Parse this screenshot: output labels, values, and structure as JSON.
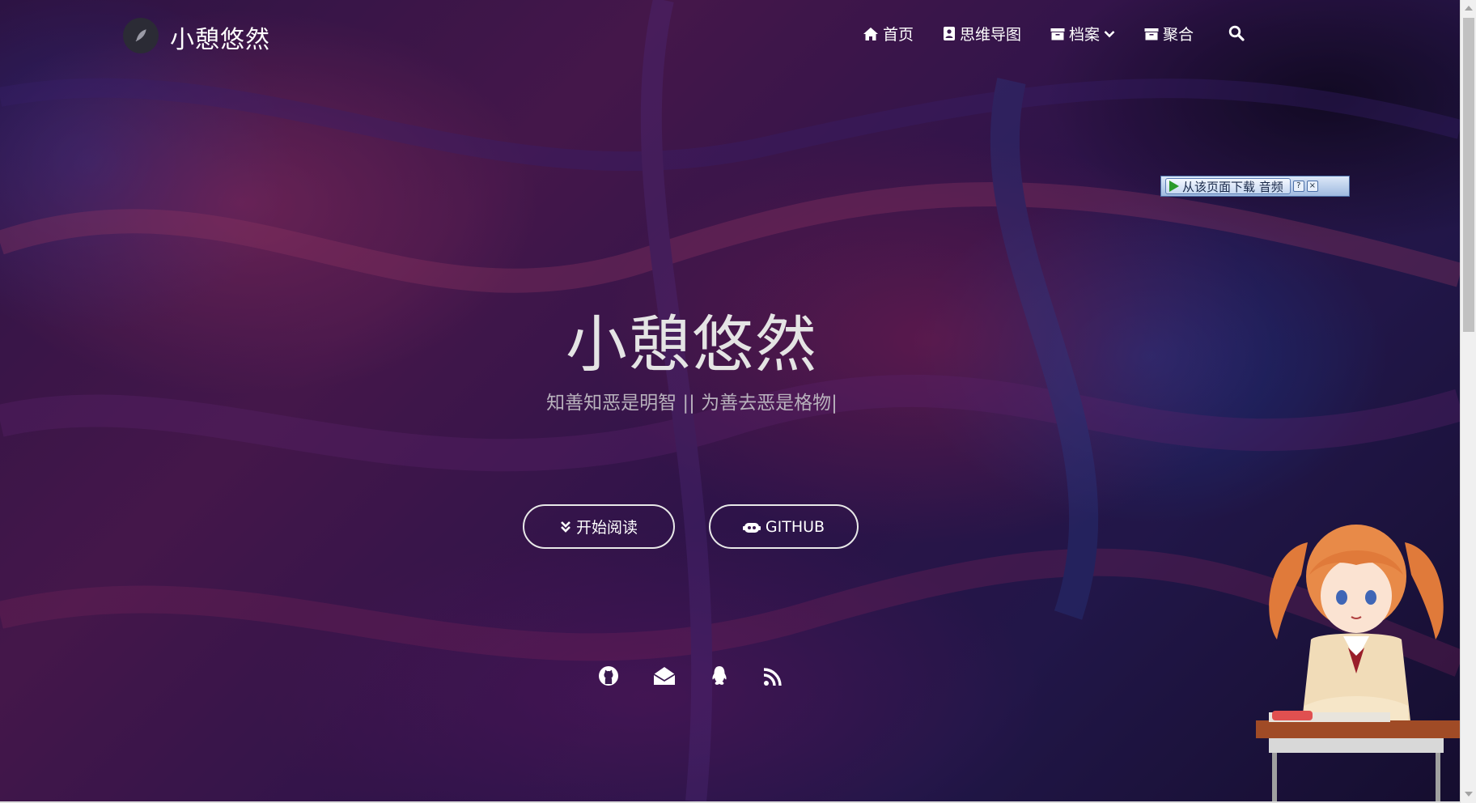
{
  "site": {
    "name": "小憩悠然"
  },
  "nav": {
    "items": [
      {
        "label": "首页",
        "icon": "home-icon"
      },
      {
        "label": "思维导图",
        "icon": "address-card-icon"
      },
      {
        "label": "档案",
        "icon": "archive-icon",
        "has_dropdown": true
      },
      {
        "label": "聚合",
        "icon": "archive-icon"
      }
    ],
    "search_icon": "search-icon"
  },
  "download_bar": {
    "label": "从该页面下载 音频",
    "help": "?",
    "close": "×"
  },
  "hero": {
    "title": "小憩悠然",
    "subtitle": "知善知恶是明智 || 为善去恶是格物|",
    "buttons": [
      {
        "label": "开始阅读",
        "icon": "double-chevron-down-icon"
      },
      {
        "label": "GITHUB",
        "icon": "gitlab-robot-icon"
      }
    ]
  },
  "social": [
    "github-icon",
    "envelope-open-icon",
    "qq-penguin-icon",
    "rss-icon"
  ],
  "colors": {
    "text": "#ffffff",
    "subtitle": "#b9b2bd",
    "accent_purple": "#5b1f5e",
    "accent_blue": "#2a1e5a"
  }
}
